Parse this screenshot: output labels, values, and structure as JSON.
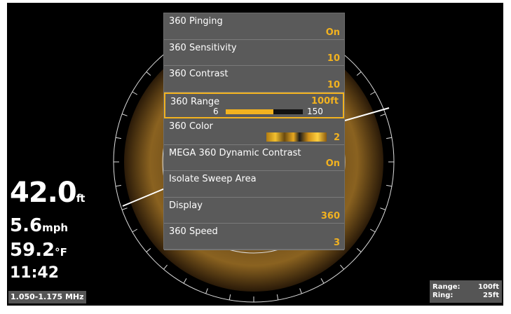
{
  "menu": {
    "items": [
      {
        "label": "360 Pinging",
        "value": "On"
      },
      {
        "label": "360 Sensitivity",
        "value": "10"
      },
      {
        "label": "360 Contrast",
        "value": "10"
      },
      {
        "label": "360 Range",
        "value": "100ft",
        "min": "6",
        "max": "150",
        "fill_fraction": 0.62
      },
      {
        "label": "360 Color",
        "value": "2"
      },
      {
        "label": "MEGA 360 Dynamic Contrast",
        "value": "On"
      },
      {
        "label": "Isolate Sweep Area",
        "value": ""
      },
      {
        "label": "Display",
        "value": "360"
      },
      {
        "label": "360 Speed",
        "value": "3"
      }
    ]
  },
  "readouts": {
    "depth_value": "42.0",
    "depth_unit": "ft",
    "speed_value": "5.6",
    "speed_unit": "mph",
    "temp_value": "59.2",
    "temp_unit": "°F",
    "time": "11:42",
    "frequency": "1.050-1.175 MHz"
  },
  "range_box": {
    "range_label": "Range:",
    "range_value": "100ft",
    "ring_label": "Ring:",
    "ring_value": "25ft"
  },
  "colors": {
    "accent": "#f2b21f",
    "menu_bg": "#5a5a5a",
    "background": "#000000"
  }
}
